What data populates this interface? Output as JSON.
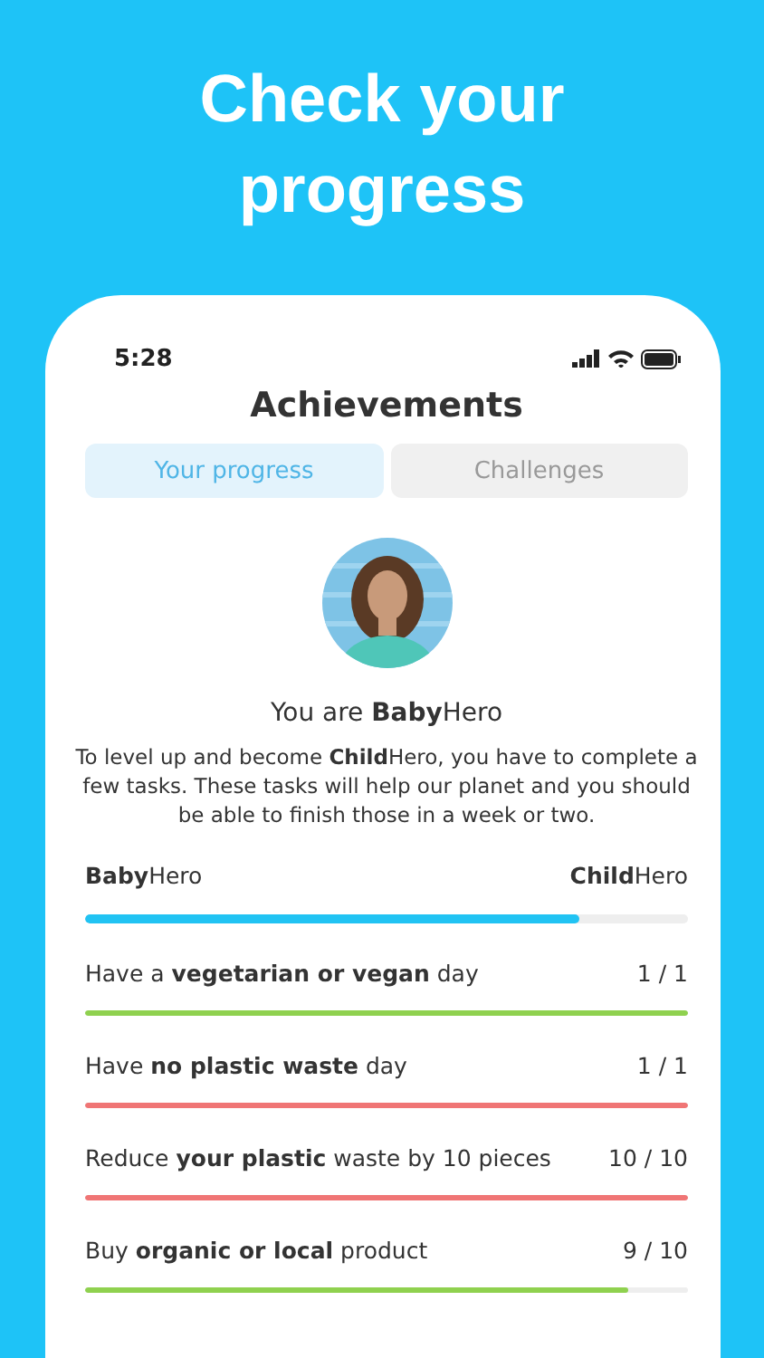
{
  "headline": "Check your progress",
  "status_bar": {
    "time": "5:28"
  },
  "title": "Achievements",
  "tabs": [
    {
      "label": "Your progress",
      "selected": true
    },
    {
      "label": "Challenges",
      "selected": false
    }
  ],
  "profile": {
    "rank": "You are **Baby**Hero",
    "description": "To level up and become **Child**Hero, you have to complete a few tasks. These tasks will help our planet and you should be able to finish those in a week or two."
  },
  "level_progress": {
    "from": "**Baby**Hero",
    "to": "**Child**Hero",
    "level": 0.82
  },
  "tasks": [
    {
      "label": "Have a **vegetarian or vegan** day",
      "count": "1 / 1",
      "level": 1,
      "color": "#8fd14f"
    },
    {
      "label": "Have **no plastic waste** day",
      "count": "1 / 1",
      "level": 1,
      "color": "#f07575"
    },
    {
      "label": "Reduce **your plastic** waste by 10 pieces",
      "count": "10 / 10",
      "level": 1,
      "color": "#f07575"
    },
    {
      "label": "Buy **organic or local** product",
      "count": "9 / 10",
      "level": 0.9,
      "color": "#8fd14f"
    }
  ]
}
